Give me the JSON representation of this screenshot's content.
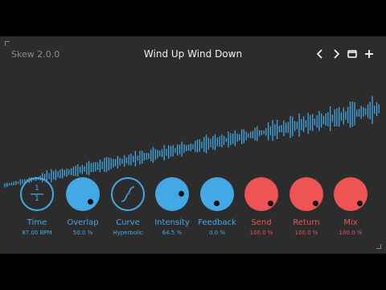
{
  "header": {
    "app_name": "Skew 2.0.0",
    "preset_name": "Wind Up Wind Down",
    "icons": [
      "chevron-left-icon",
      "chevron-right-icon",
      "window-icon",
      "plus-icon"
    ]
  },
  "time_knob": {
    "numerator": "1",
    "denominator": "1"
  },
  "controls": [
    {
      "label": "Time",
      "value": "87.00 BPM"
    },
    {
      "label": "Overlap",
      "value": "50.0 %"
    },
    {
      "label": "Curve",
      "value": "Hyperbolic"
    },
    {
      "label": "Intensity",
      "value": "64.5 %"
    },
    {
      "label": "Feedback",
      "value": "0.0 %"
    },
    {
      "label": "Send",
      "value": "100.0 %"
    },
    {
      "label": "Return",
      "value": "100.0 %"
    },
    {
      "label": "Mix",
      "value": "100.0 %"
    }
  ],
  "colors": {
    "accent": "#43a8e6",
    "accent_red": "#ee5454",
    "panel": "#2c2c2c",
    "text": "#f2f2f2"
  }
}
